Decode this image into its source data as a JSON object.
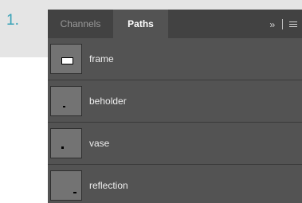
{
  "step": {
    "number": "1."
  },
  "panel": {
    "tabs": [
      {
        "label": "Channels",
        "active": false
      },
      {
        "label": "Paths",
        "active": true
      }
    ],
    "controls": {
      "collapse_icon": "double-chevron-right-icon",
      "menu_icon": "hamburger-menu-icon"
    },
    "paths": [
      {
        "name": "frame",
        "thumbnail_icon": "rectangle-thumbnail"
      },
      {
        "name": "beholder",
        "thumbnail_icon": "small-dot-thumbnail"
      },
      {
        "name": "vase",
        "thumbnail_icon": "small-dot-thumbnail"
      },
      {
        "name": "reflection",
        "thumbnail_icon": "small-dash-thumbnail"
      }
    ]
  },
  "colors": {
    "step_number": "#3aa3b8",
    "panel_bg": "#535353",
    "tabbar_bg": "#424242",
    "active_tab_text": "#ffffff"
  }
}
